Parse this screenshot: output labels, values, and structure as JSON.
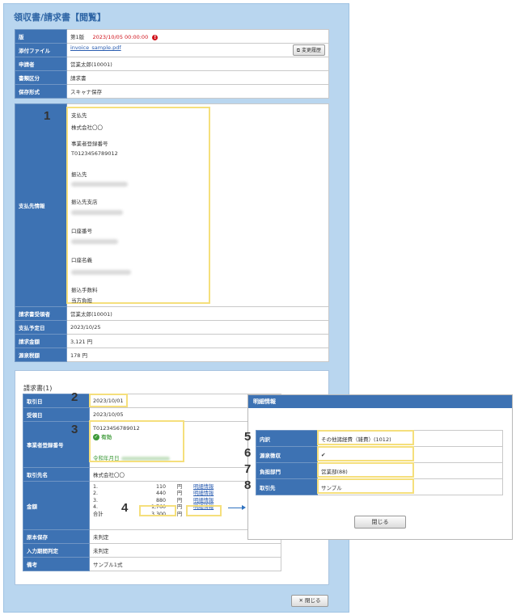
{
  "page_title": "領収書/請求書【閲覧】",
  "info_rows": [
    {
      "label": "版",
      "edition": "第1版",
      "timestamp": "2023/10/05 00:00:00",
      "alert_icon": "alert-icon"
    },
    {
      "label": "添付ファイル",
      "value": "invoice_sample.pdf",
      "button": "変更履歴"
    },
    {
      "label": "申請者",
      "value": "営業太郎(10001)"
    },
    {
      "label": "書類区分",
      "value": "請求書"
    },
    {
      "label": "保存形式",
      "value": "スキャナ保存"
    }
  ],
  "payment": {
    "label": "支払先情報",
    "marker": "1",
    "payee_title": "支払先",
    "payee_value": "株式会社〇〇",
    "reg_title": "事業者登録番号",
    "reg_value": "T0123456789012",
    "bank_title": "振込先",
    "branch_title": "振込先支店",
    "account_title": "口座番号",
    "holder_title": "口座名義",
    "fee_title": "振込手数料",
    "fee_value": "当方負担"
  },
  "payment_rows": [
    {
      "label": "請求書受領者",
      "value": "営業太郎(10001)"
    },
    {
      "label": "支払予定日",
      "value": "2023/10/25"
    },
    {
      "label": "請求金額",
      "value": "3,121 円"
    },
    {
      "label": "源泉税額",
      "value": "178 円"
    }
  ],
  "invoice": {
    "title": "請求書(1)",
    "rows": {
      "transaction_date_label": "取引日",
      "transaction_date": "2023/10/01",
      "receipt_date_label": "受領日",
      "receipt_date": "2023/10/05",
      "reg_label": "事業者登録番号",
      "reg_value": "T0123456789012",
      "valid_label": "有効",
      "valid_icon": "check-circle-icon",
      "reg_date_label": "令和年月日",
      "partner_label": "取引先名",
      "partner_value": "株式会社〇〇",
      "amount_label": "金額",
      "original_label": "原本保存",
      "original_value": "未判定",
      "deadline_label": "入力期間判定",
      "deadline_value": "未判定",
      "remarks_label": "備考",
      "remarks_value": "サンプル1式"
    },
    "amount_lines": [
      {
        "idx": "1.",
        "value": "110",
        "unit": "円",
        "link": "明細情報"
      },
      {
        "idx": "2.",
        "value": "440",
        "unit": "円",
        "link": "明細情報"
      },
      {
        "idx": "3.",
        "value": "880",
        "unit": "円",
        "link": "明細情報"
      },
      {
        "idx": "4.",
        "value": "1,760",
        "unit": "円",
        "link": "明細情報"
      }
    ],
    "total_label": "合計",
    "total_value": "3,300",
    "total_unit": "円",
    "markers": [
      "2",
      "3",
      "4"
    ]
  },
  "close_button": "閉じる",
  "close_icon": "close-icon",
  "detail": {
    "header": "明細情報",
    "rows": [
      {
        "marker": "5",
        "label": "内訳",
        "value": "その他諸経費（雑費）(1012)"
      },
      {
        "marker": "6",
        "label": "源泉徴収",
        "value": "✔"
      },
      {
        "marker": "7",
        "label": "負担部門",
        "value": "営業部(88)"
      },
      {
        "marker": "8",
        "label": "取引先",
        "value": "サンプル"
      }
    ],
    "close_button": "閉じる"
  }
}
